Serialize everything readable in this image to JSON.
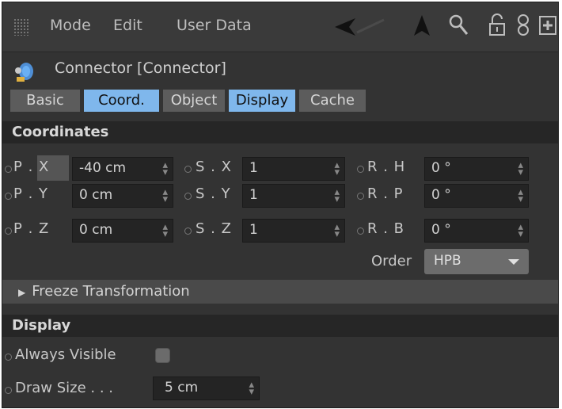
{
  "menu": {
    "mode": "Mode",
    "edit": "Edit",
    "user_data": "User Data"
  },
  "toolbar_icons": [
    "back-arrow-icon",
    "cursor-arrow-icon",
    "search-icon",
    "lock-icon",
    "link-icon",
    "new-panel-icon"
  ],
  "header": {
    "title": "Connector [Connector]"
  },
  "tabs": [
    {
      "label": "Basic",
      "active": false
    },
    {
      "label": "Coord.",
      "active": true
    },
    {
      "label": "Object",
      "active": false
    },
    {
      "label": "Display",
      "active": true
    },
    {
      "label": "Cache",
      "active": false
    }
  ],
  "coordinates": {
    "header": "Coordinates",
    "px": {
      "label": "P . X",
      "value": "-40 cm"
    },
    "py": {
      "label": "P . Y",
      "value": "0 cm"
    },
    "pz": {
      "label": "P . Z",
      "value": "0 cm"
    },
    "sx": {
      "label": "S . X",
      "value": "1"
    },
    "sy": {
      "label": "S . Y",
      "value": "1"
    },
    "sz": {
      "label": "S . Z",
      "value": "1"
    },
    "rh": {
      "label": "R . H",
      "value": "0 °"
    },
    "rp": {
      "label": "R . P",
      "value": "0 °"
    },
    "rb": {
      "label": "R . B",
      "value": "0 °"
    },
    "order": {
      "label": "Order",
      "value": "HPB"
    },
    "freeze": "Freeze Transformation"
  },
  "display": {
    "header": "Display",
    "always_visible": {
      "label": "Always Visible",
      "checked": false
    },
    "draw_size": {
      "label": "Draw Size . . .",
      "value": "5 cm"
    }
  },
  "colors": {
    "accent_tab": "#7fb7ec",
    "panel_bg": "#333333",
    "section_bg": "#262626"
  }
}
